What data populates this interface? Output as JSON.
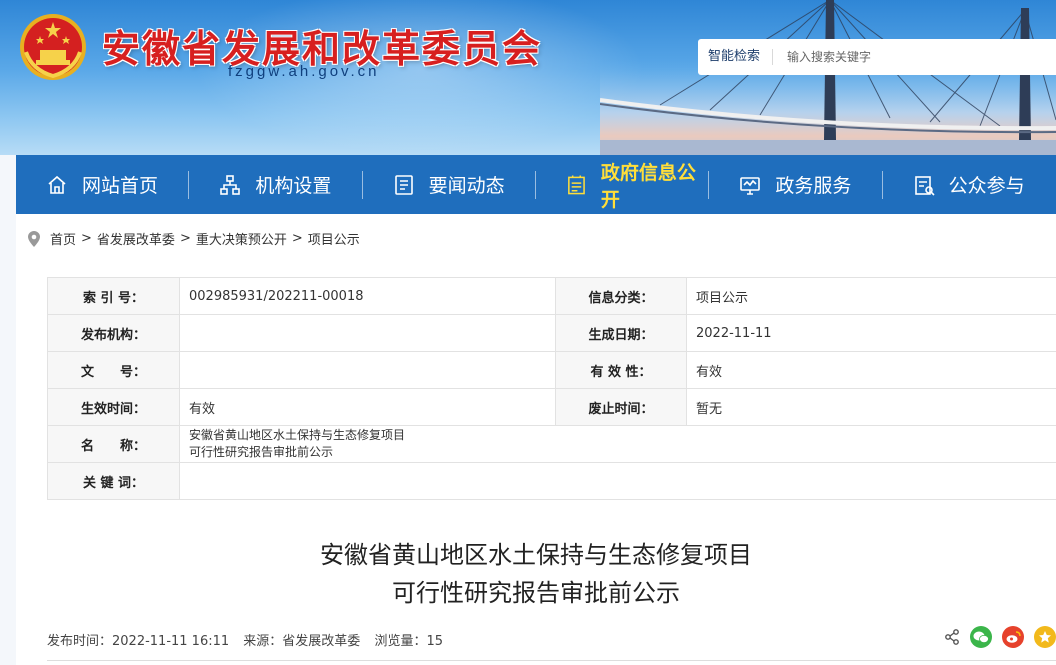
{
  "header": {
    "title": "安徽省发展和改革委员会",
    "domain": "fzggw.ah.gov.cn",
    "search_label": "智能检索",
    "search_placeholder": "输入搜索关键字"
  },
  "nav": {
    "items": [
      {
        "label": "网站首页",
        "icon": "home-icon"
      },
      {
        "label": "机构设置",
        "icon": "org-chart-icon"
      },
      {
        "label": "要闻动态",
        "icon": "news-icon"
      },
      {
        "label": "政府信息公开",
        "icon": "document-icon",
        "active": true
      },
      {
        "label": "政务服务",
        "icon": "monitor-icon"
      },
      {
        "label": "公众参与",
        "icon": "form-icon"
      }
    ]
  },
  "breadcrumb": [
    "首页",
    "省发展改革委",
    "重大决策预公开",
    "项目公示"
  ],
  "breadcrumb_separator": ">",
  "meta": {
    "index_label": "索 引 号：",
    "index_value": "002985931/202211-00018",
    "category_label": "信息分类：",
    "category_value": "项目公示",
    "publisher_label": "发布机构：",
    "publisher_value": "",
    "created_label": "生成日期：",
    "created_value": "2022-11-11",
    "doc_no_label": "文　　号：",
    "doc_no_value": "",
    "validity_label": "有 效 性：",
    "validity_value": "有效",
    "effective_label": "生效时间：",
    "effective_value": "有效",
    "expiry_label": "废止时间：",
    "expiry_value": "暂无",
    "name_label": "名　　称：",
    "name_line1": "安徽省黄山地区水土保持与生态修复项目",
    "name_line2": "可行性研究报告审批前公示",
    "keywords_label": "关 键 词：",
    "keywords_value": ""
  },
  "article": {
    "title_line1": "安徽省黄山地区水土保持与生态修复项目",
    "title_line2": "可行性研究报告审批前公示",
    "publish_time": "发布时间：2022-11-11 16:11",
    "source": "来源：省发展改革委",
    "views": "浏览量：15"
  },
  "colors": {
    "nav_bg": "#1f6ebd",
    "nav_active": "#ffde3a",
    "title_red": "#d71f1f"
  }
}
